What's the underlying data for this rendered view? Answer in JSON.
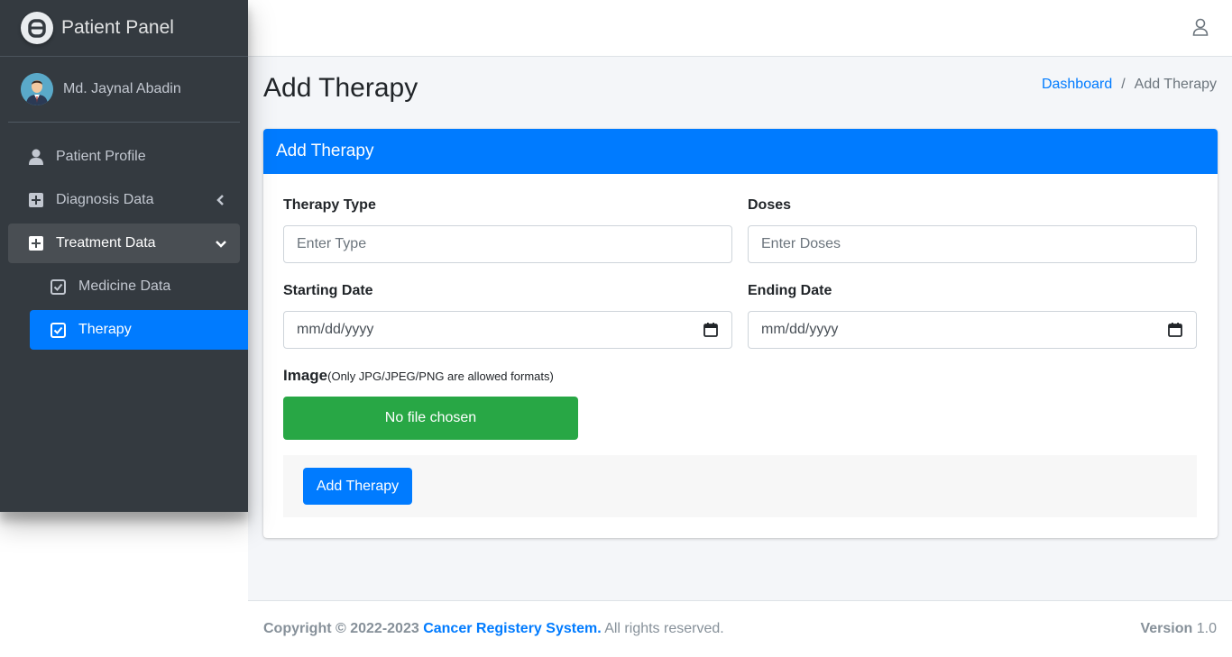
{
  "sidebar": {
    "brand": "Patient Panel",
    "user_name": "Md. Jaynal Abadin",
    "items": [
      {
        "label": "Patient Profile",
        "icon": "user-icon"
      },
      {
        "label": "Diagnosis Data",
        "icon": "plus-square-icon"
      },
      {
        "label": "Treatment Data",
        "icon": "plus-square-icon"
      }
    ],
    "sub_items": [
      {
        "label": "Medicine Data",
        "icon": "check-square-icon"
      },
      {
        "label": "Therapy",
        "icon": "check-square-icon"
      }
    ]
  },
  "page": {
    "title": "Add Therapy",
    "breadcrumb": {
      "link": "Dashboard",
      "separator": "/",
      "active": "Add Therapy"
    }
  },
  "form": {
    "header": "Add Therapy",
    "therapy_type_label": "Therapy Type",
    "therapy_type_placeholder": "Enter Type",
    "doses_label": "Doses",
    "doses_placeholder": "Enter Doses",
    "start_label": "Starting Date",
    "start_value": "mm/dd/yyyy",
    "end_label": "Ending Date",
    "end_value": "mm/dd/yyyy",
    "image_label": "Image",
    "image_hint": "(Only JPG/JPEG/PNG are allowed formats)",
    "file_button": "No file chosen",
    "submit": "Add Therapy"
  },
  "footer": {
    "copyright_prefix": "Copyright © 2022-2023",
    "brand": "Cancer Registery System.",
    "rights": "All rights reserved.",
    "version_label": "Version",
    "version_value": "1.0"
  },
  "colors": {
    "primary": "#007bff",
    "success": "#28a745",
    "sidebar_bg": "#343a40",
    "content_bg": "#f4f6f9"
  }
}
